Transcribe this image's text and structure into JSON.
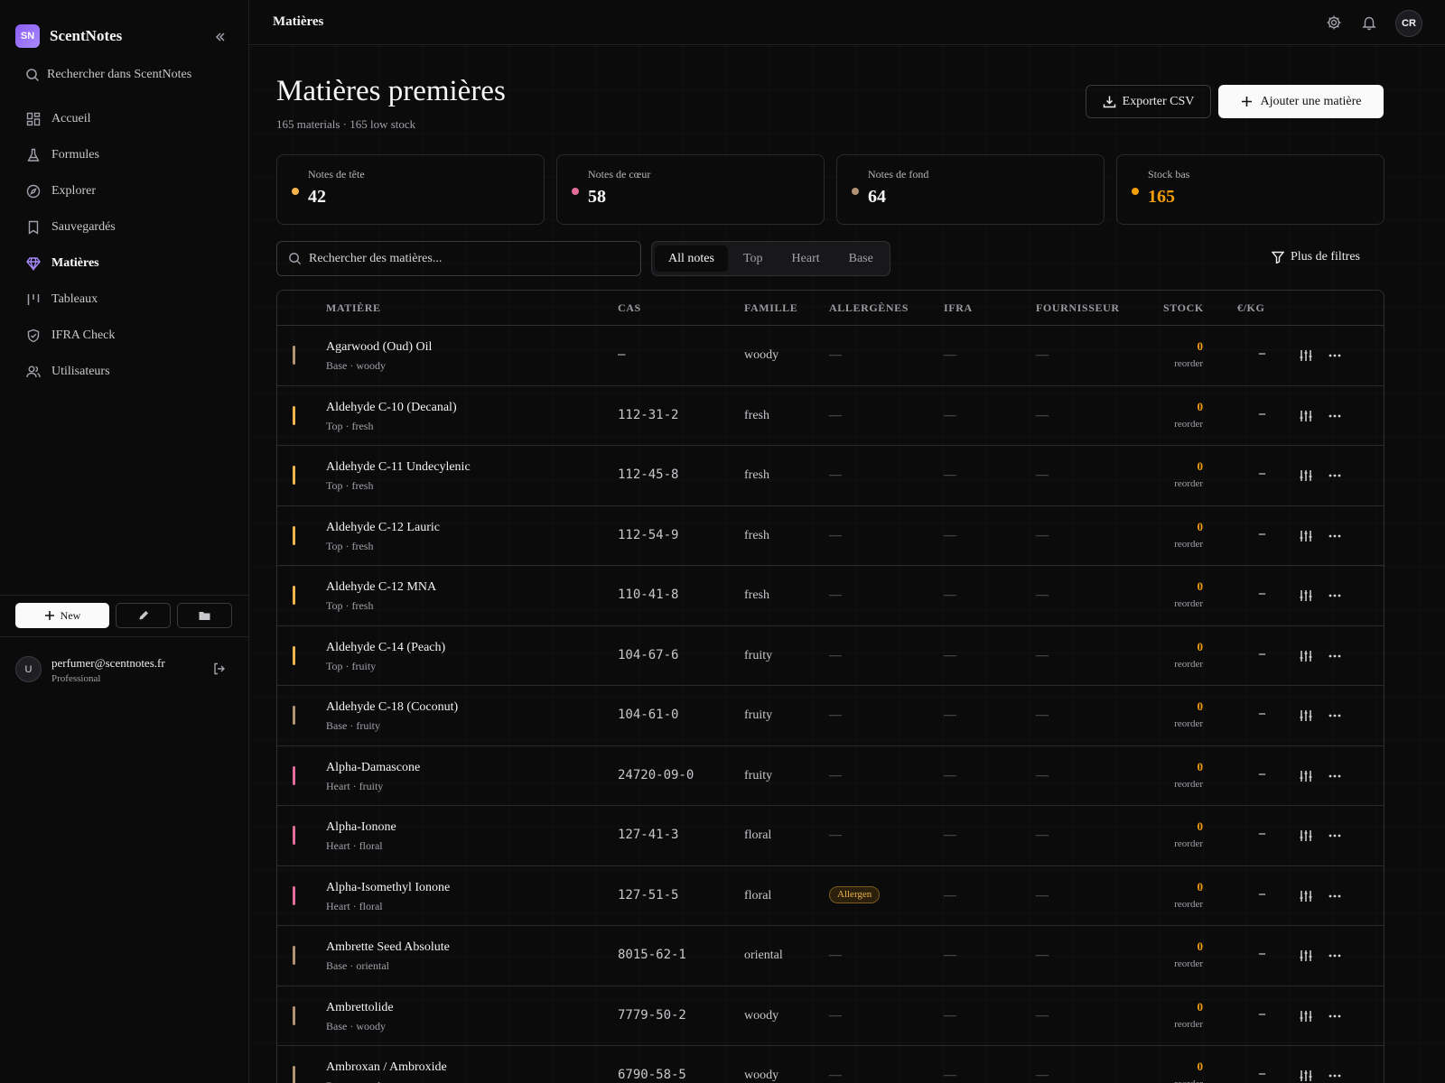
{
  "brand": {
    "logo_text": "SN",
    "name": "ScentNotes"
  },
  "sidebar": {
    "search_placeholder": "Rechercher dans ScentNotes",
    "items": [
      {
        "label": "Accueil",
        "icon": "dashboard-icon",
        "active": false
      },
      {
        "label": "Formules",
        "icon": "flask-icon",
        "active": false
      },
      {
        "label": "Explorer",
        "icon": "compass-icon",
        "active": false
      },
      {
        "label": "Sauvegardés",
        "icon": "bookmark-icon",
        "active": false
      },
      {
        "label": "Matières",
        "icon": "gem-icon",
        "active": true
      },
      {
        "label": "Tableaux",
        "icon": "columns-icon",
        "active": false
      },
      {
        "label": "IFRA Check",
        "icon": "shield-check-icon",
        "active": false
      },
      {
        "label": "Utilisateurs",
        "icon": "users-icon",
        "active": false
      }
    ],
    "new_label": "New"
  },
  "user": {
    "initial": "U",
    "email": "perfumer@scentnotes.fr",
    "plan": "Professional"
  },
  "topbar": {
    "breadcrumb": "Matières",
    "avatar_initials": "CR"
  },
  "page": {
    "title": "Matières premières",
    "subtitle": "165 materials · 165 low stock",
    "export_label": "Exporter CSV",
    "add_label": "Ajouter une matière"
  },
  "stats": [
    {
      "label": "Notes de tête",
      "value": "42",
      "dot_color": "#f5b54a",
      "value_color": "#f7f7f8"
    },
    {
      "label": "Notes de cœur",
      "value": "58",
      "dot_color": "#e26d9a",
      "value_color": "#f7f7f8"
    },
    {
      "label": "Notes de fond",
      "value": "64",
      "dot_color": "#b39274",
      "value_color": "#f7f7f8"
    },
    {
      "label": "Stock bas",
      "value": "165",
      "dot_color": "#f59e0b",
      "value_color": "#f59e0b"
    }
  ],
  "filters": {
    "search_placeholder": "Rechercher des matières...",
    "segments": [
      {
        "label": "All notes",
        "active": true
      },
      {
        "label": "Top",
        "active": false
      },
      {
        "label": "Heart",
        "active": false
      },
      {
        "label": "Base",
        "active": false
      }
    ],
    "more_label": "Plus de filtres"
  },
  "table": {
    "columns": [
      "MATIÈRE",
      "CAS",
      "FAMILLE",
      "ALLERGÈNES",
      "IFRA",
      "FOURNISSEUR",
      "STOCK",
      "€/KG"
    ],
    "note_colors": {
      "Top": "#f5b54a",
      "Heart": "#e26d9a",
      "Base": "#b39274"
    },
    "empty": "—",
    "reorder_label": "reorder",
    "rows": [
      {
        "name": "Agarwood (Oud) Oil",
        "note": "Base",
        "meta": "Base · woody",
        "cas": "—",
        "family": "woody",
        "allergens": "",
        "stock": "0",
        "price": "–"
      },
      {
        "name": "Aldehyde C-10 (Decanal)",
        "note": "Top",
        "meta": "Top · fresh",
        "cas": "112-31-2",
        "family": "fresh",
        "allergens": "",
        "stock": "0",
        "price": "–"
      },
      {
        "name": "Aldehyde C-11 Undecylenic",
        "note": "Top",
        "meta": "Top · fresh",
        "cas": "112-45-8",
        "family": "fresh",
        "allergens": "",
        "stock": "0",
        "price": "–"
      },
      {
        "name": "Aldehyde C-12 Lauric",
        "note": "Top",
        "meta": "Top · fresh",
        "cas": "112-54-9",
        "family": "fresh",
        "allergens": "",
        "stock": "0",
        "price": "–"
      },
      {
        "name": "Aldehyde C-12 MNA",
        "note": "Top",
        "meta": "Top · fresh",
        "cas": "110-41-8",
        "family": "fresh",
        "allergens": "",
        "stock": "0",
        "price": "–"
      },
      {
        "name": "Aldehyde C-14 (Peach)",
        "note": "Top",
        "meta": "Top · fruity",
        "cas": "104-67-6",
        "family": "fruity",
        "allergens": "",
        "stock": "0",
        "price": "–"
      },
      {
        "name": "Aldehyde C-18 (Coconut)",
        "note": "Base",
        "meta": "Base · fruity",
        "cas": "104-61-0",
        "family": "fruity",
        "allergens": "",
        "stock": "0",
        "price": "–"
      },
      {
        "name": "Alpha-Damascone",
        "note": "Heart",
        "meta": "Heart · fruity",
        "cas": "24720-09-0",
        "family": "fruity",
        "allergens": "",
        "stock": "0",
        "price": "–"
      },
      {
        "name": "Alpha-Ionone",
        "note": "Heart",
        "meta": "Heart · floral",
        "cas": "127-41-3",
        "family": "floral",
        "allergens": "",
        "stock": "0",
        "price": "–"
      },
      {
        "name": "Alpha-Isomethyl Ionone",
        "note": "Heart",
        "meta": "Heart · floral",
        "cas": "127-51-5",
        "family": "floral",
        "allergens": "Allergen",
        "stock": "0",
        "price": "–"
      },
      {
        "name": "Ambrette Seed Absolute",
        "note": "Base",
        "meta": "Base · oriental",
        "cas": "8015-62-1",
        "family": "oriental",
        "allergens": "",
        "stock": "0",
        "price": "–"
      },
      {
        "name": "Ambrettolide",
        "note": "Base",
        "meta": "Base · woody",
        "cas": "7779-50-2",
        "family": "woody",
        "allergens": "",
        "stock": "0",
        "price": "–"
      },
      {
        "name": "Ambroxan / Ambroxide",
        "note": "Base",
        "meta": "Base · woody",
        "cas": "6790-58-5",
        "family": "woody",
        "allergens": "",
        "stock": "0",
        "price": "–"
      }
    ]
  }
}
